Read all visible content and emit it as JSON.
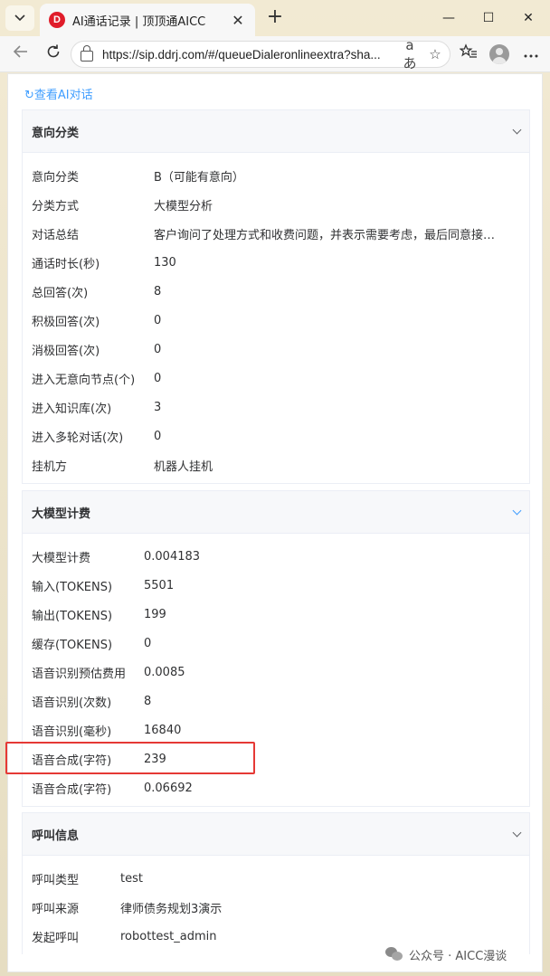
{
  "browser": {
    "tab_title": "AI通话记录 | 顶顶通AICC",
    "favicon_letter": "D",
    "url": "https://sip.ddrj.com/#/queueDialeronlineextra?sha...",
    "controls": {
      "minimize": "—",
      "maximize": "☐",
      "close": "✕"
    },
    "tab_close": "✕",
    "new_tab": "+",
    "read_aloud": "aあ",
    "favorite": "☆",
    "favorites_list": "☆≡"
  },
  "page": {
    "back_link": "↻查看AI对话",
    "sections": [
      {
        "title": "意向分类",
        "expanded": true,
        "rows": [
          {
            "label": "意向分类",
            "value": "B（可能有意向）"
          },
          {
            "label": "分类方式",
            "value": "大模型分析"
          },
          {
            "label": "对话总结",
            "value": "客户询问了处理方式和收费问题，并表示需要考虑，最后同意接…"
          },
          {
            "label": "通话时长(秒)",
            "value": "130"
          },
          {
            "label": "总回答(次)",
            "value": "8"
          },
          {
            "label": "积极回答(次)",
            "value": "0"
          },
          {
            "label": "消极回答(次)",
            "value": "0"
          },
          {
            "label": "进入无意向节点(个)",
            "value": "0"
          },
          {
            "label": "进入知识库(次)",
            "value": "3"
          },
          {
            "label": "进入多轮对话(次)",
            "value": "0"
          },
          {
            "label": "挂机方",
            "value": "机器人挂机"
          }
        ]
      },
      {
        "title": "大模型计费",
        "expanded": true,
        "rows": [
          {
            "label": "大模型计费",
            "value": "0.004183"
          },
          {
            "label": "输入(TOKENS)",
            "value": "5501"
          },
          {
            "label": "输出(TOKENS)",
            "value": "199"
          },
          {
            "label": "缓存(TOKENS)",
            "value": "0"
          },
          {
            "label": "语音识别预估费用",
            "value": "0.0085"
          },
          {
            "label": "语音识别(次数)",
            "value": "8"
          },
          {
            "label": "语音识别(毫秒)",
            "value": "16840"
          },
          {
            "label": "语音合成(字符)",
            "value": "239"
          },
          {
            "label": "语音合成(字符)",
            "value": "0.06692"
          }
        ]
      },
      {
        "title": "呼叫信息",
        "expanded": true,
        "rows": [
          {
            "label": "呼叫类型",
            "value": "test"
          },
          {
            "label": "呼叫来源",
            "value": "律师债务规划3演示"
          },
          {
            "label": "发起呼叫",
            "value": "robottest_admin"
          }
        ]
      }
    ]
  },
  "watermark": "公众号 · AICC漫谈",
  "colors": {
    "link": "#409eff",
    "highlight": "#e53935",
    "header_bg": "#f7f8fa"
  }
}
